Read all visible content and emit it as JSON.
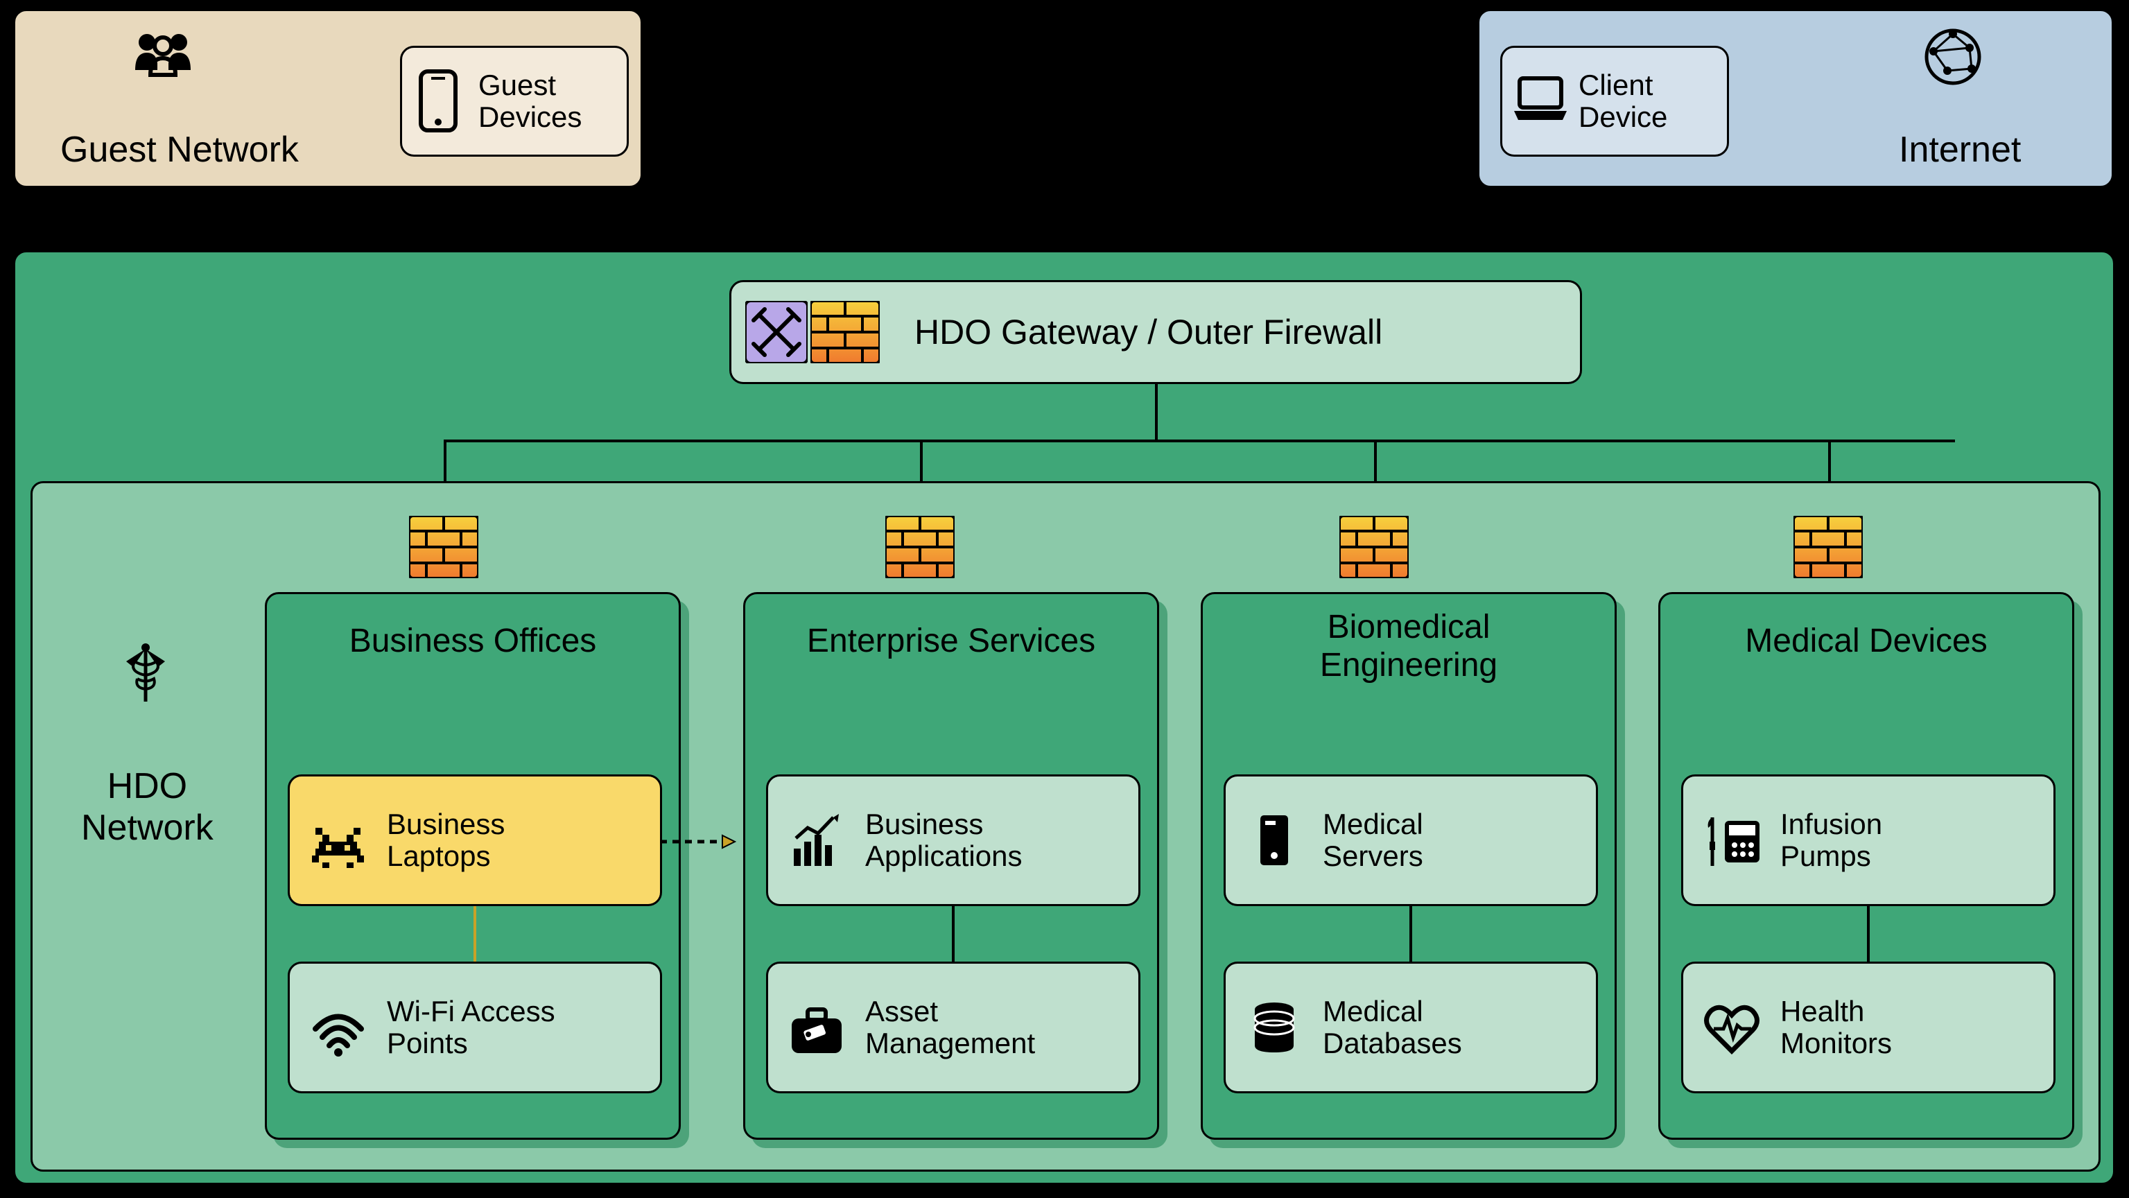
{
  "guestNetwork": {
    "title": "Guest Network",
    "card": "Guest\nDevices"
  },
  "internet": {
    "title": "Internet",
    "card": "Client\nDevice"
  },
  "gateway": {
    "label": "HDO Gateway / Outer Firewall"
  },
  "hdo": {
    "title": "HDO\nNetwork"
  },
  "zones": {
    "business": {
      "title": "Business Offices",
      "c1": "Business\nLaptops",
      "c2": "Wi-Fi Access\nPoints"
    },
    "enterprise": {
      "title": "Enterprise Services",
      "c1": "Business\nApplications",
      "c2": "Asset\nManagement"
    },
    "biomed": {
      "title": "Biomedical\nEngineering",
      "c1": "Medical\nServers",
      "c2": "Medical\nDatabases"
    },
    "medical": {
      "title": "Medical Devices",
      "c1": "Infusion\nPumps",
      "c2": "Health\nMonitors"
    }
  },
  "colors": {
    "tan": "#e8d9bd",
    "blue": "#b7cde0",
    "greenDark": "#3fa778",
    "greenMid": "#8bc9a9",
    "greenLight": "#bfe0ce",
    "yellow": "#f9d96a"
  }
}
